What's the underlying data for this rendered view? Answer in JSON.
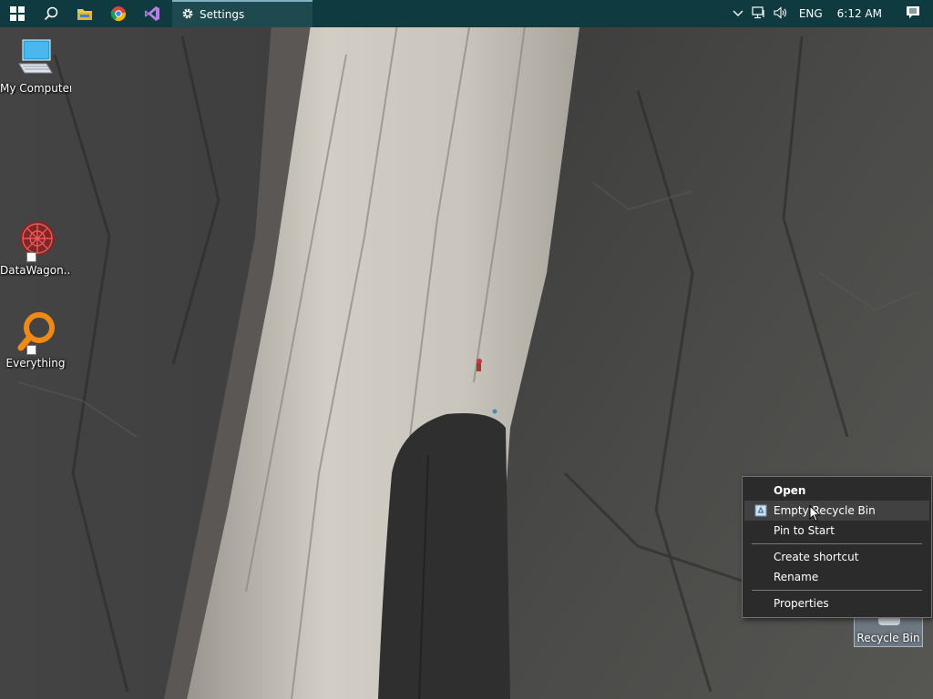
{
  "taskbar": {
    "start_icon": "windows-logo-icon",
    "search_icon": "search-icon",
    "pinned": [
      {
        "name": "file-explorer",
        "icon": "folder-icon"
      },
      {
        "name": "chrome",
        "icon": "chrome-icon"
      },
      {
        "name": "visual-studio",
        "icon": "visual-studio-icon"
      }
    ],
    "open_app": {
      "label": "Settings",
      "icon": "gear-icon"
    },
    "tray": {
      "chevron_icon": "chevron-up-icon",
      "network_icon": "network-icon",
      "volume_icon": "volume-icon",
      "language": "ENG",
      "clock": "6:12 AM",
      "notification_icon": "notification-icon"
    }
  },
  "desktop": {
    "icons": [
      {
        "label": "My Computer",
        "icon": "computer-icon"
      },
      {
        "label": "DataWagon...",
        "icon": "datawagon-icon"
      },
      {
        "label": "Everything",
        "icon": "everything-search-icon"
      }
    ],
    "recycle_bin": {
      "label": "Recycle Bin",
      "icon": "recycle-bin-icon"
    }
  },
  "context_menu": {
    "items": [
      {
        "label": "Open",
        "bold": true
      },
      {
        "label": "Empty Recycle Bin",
        "icon": "recycle-bin-icon",
        "highlighted": true
      },
      {
        "label": "Pin to Start"
      },
      {
        "label": "Create shortcut"
      },
      {
        "label": "Rename"
      },
      {
        "label": "Properties"
      }
    ]
  },
  "colors": {
    "taskbar_bg": "#0f3a3f",
    "menu_bg": "#2b2b2b",
    "menu_highlight": "#414141",
    "accent": "#7fb1c0"
  }
}
